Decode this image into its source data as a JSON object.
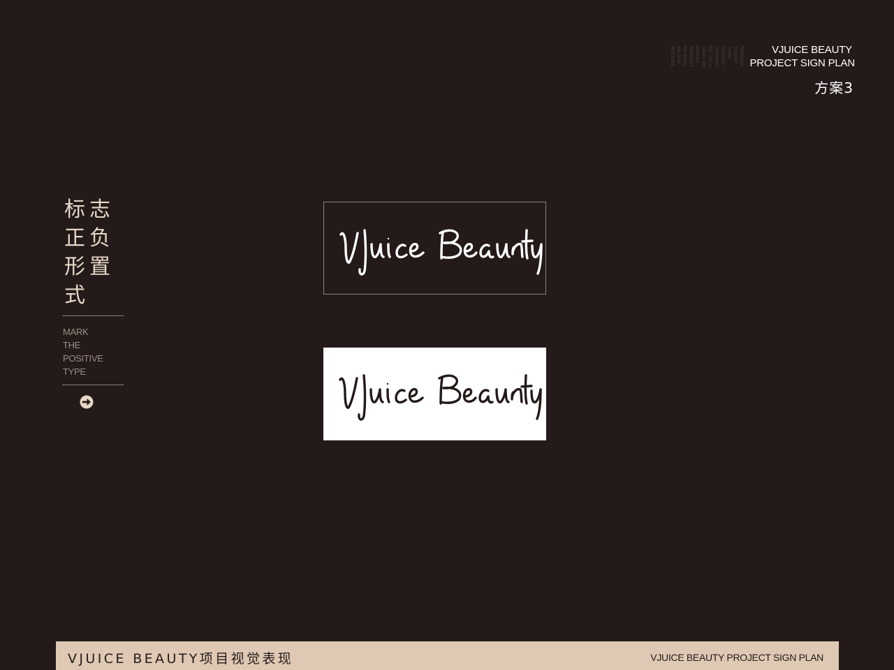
{
  "header": {
    "line1": "VJUICE BEAUTY",
    "line2": "PROJECT SIGN PLAN",
    "plan": "方案3",
    "vertical_text": [
      "REPRODUC-",
      "TION BY",
      "THIRD",
      "PARTIES IS",
      "PROHIBIT-",
      "ED. The color",
      "values and",
      "numbers",
      "obtained in",
      "the above",
      "are color",
      "PANTONE"
    ]
  },
  "sidebar": {
    "title_chars": [
      "标",
      "志",
      "正",
      "负",
      "形",
      "置",
      "式"
    ],
    "subtitle": [
      "MARK",
      "THE",
      "POSITIVE",
      "TYPE"
    ],
    "arrow_icon": "arrow-right-circle-icon"
  },
  "logos": {
    "wordmark": "Vjuice Beauty",
    "dark_variant_text_color": "#ffffff",
    "light_variant_text_color": "#231a19"
  },
  "footer": {
    "left": "VJUICE BEAUTY项目视觉表现",
    "right": "VJUICE BEAUTY PROJECT SIGN PLAN"
  },
  "colors": {
    "background": "#231a19",
    "accent": "#dfc9b4",
    "text_light": "#e6d6c6"
  }
}
